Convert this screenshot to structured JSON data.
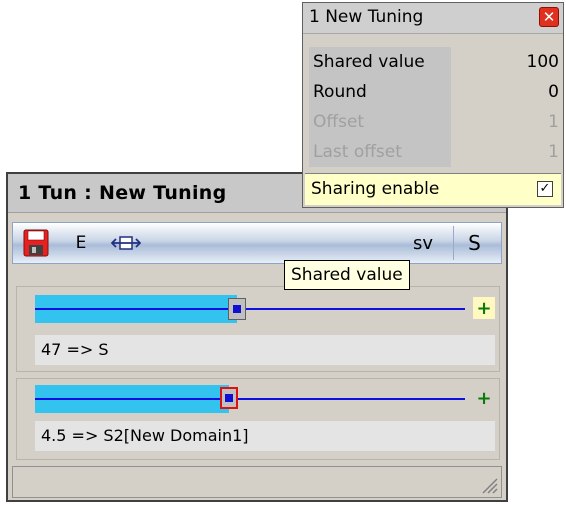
{
  "popup": {
    "title": "1  New Tuning",
    "close_glyph": "✕",
    "rows": [
      {
        "label": "Shared value",
        "value": "100",
        "enabled": true
      },
      {
        "label": "Round",
        "value": "0",
        "enabled": true
      },
      {
        "label": "Offset",
        "value": "1",
        "enabled": false
      },
      {
        "label": "Last offset",
        "value": "1",
        "enabled": false
      }
    ],
    "sharing_label": "Sharing enable",
    "sharing_checked": "✓"
  },
  "window": {
    "title": "1  Tun : New Tuning",
    "toolbar": {
      "save_icon": "save-icon",
      "e_label": "E",
      "fit_icon": "fit-width-icon",
      "sv_label": "sv",
      "s_label": "S"
    },
    "tooltip": "Shared value",
    "sliders": [
      {
        "value_text": "47 => S",
        "fill_fraction": 0.47,
        "plus": "+"
      },
      {
        "value_text": "4.5 => S2[New Domain1]",
        "fill_fraction": 0.45,
        "plus": "+"
      }
    ]
  },
  "colors": {
    "slider_fill": "#33c3ef",
    "slider_line": "#1010e0",
    "accent_red": "#e01010",
    "tooltip_bg": "#ffffe1"
  }
}
